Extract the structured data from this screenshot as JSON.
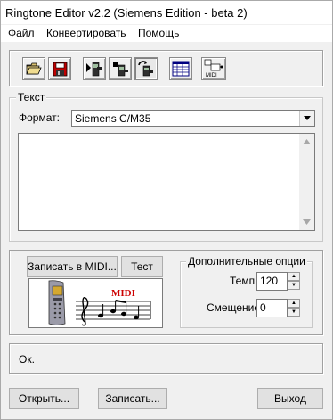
{
  "window": {
    "title": "Ringtone Editor v2.2 (Siemens Edition - beta 2)"
  },
  "menu": {
    "file": "Файл",
    "convert": "Конвертировать",
    "help": "Помощь"
  },
  "toolbar": {
    "icons": [
      "open-folder-icon",
      "save-disk-icon",
      "phone-in-icon",
      "phone-out-icon",
      "phone-sync-icon",
      "spreadsheet-icon",
      "midi-icon"
    ],
    "midi_icon_text": "MIDI"
  },
  "text_group": {
    "label": "Текст",
    "format_label": "Формат:",
    "format_value": "Siemens C/M35",
    "text_value": ""
  },
  "midi_section": {
    "record_midi_button": "Записать в MIDI...",
    "test_button": "Тест",
    "banner_text": "MIDI",
    "colors": {
      "midi_red": "#cc0000",
      "phone_body": "#9a9aa8"
    }
  },
  "options": {
    "label": "Дополнительные опции",
    "tempo_label": "Темп:",
    "tempo_value": "120",
    "offset_label": "Смещение:",
    "offset_value": "0"
  },
  "status": {
    "text": "Ок."
  },
  "buttons": {
    "open": "Открыть...",
    "save": "Записать...",
    "exit": "Выход"
  }
}
